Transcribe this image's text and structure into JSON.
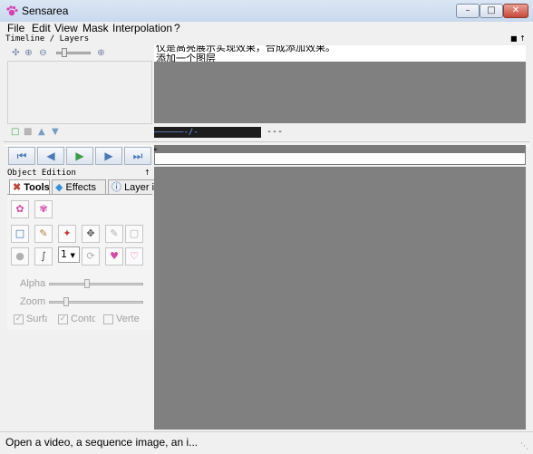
{
  "window": {
    "title": "Sensarea",
    "min_label": "–",
    "max_label": "□",
    "close_label": "✕"
  },
  "menu": [
    "File",
    "Edit",
    "View",
    "Mask",
    "Interpolation",
    "?"
  ],
  "timeline": {
    "header": "Timeline / Layers",
    "header_buttons": "■ ↑",
    "text_line1": "仅是高亮展示实现效果，合成添加效果。",
    "text_line2": "添加一个图层",
    "track_label": "——————-/-",
    "track_dashes": "---",
    "frame_marker": "▸"
  },
  "transport": {
    "first": "⏮",
    "prev": "◀",
    "play": "▶",
    "next": "▶",
    "last": "⏭"
  },
  "object_edition": {
    "header": "Object Edition",
    "pin": "↑",
    "tabs": [
      {
        "label": "Tools",
        "icon": "tools-icon"
      },
      {
        "label": "Effects",
        "icon": "effects-icon"
      },
      {
        "label": "Layer info",
        "icon": "info-icon"
      }
    ],
    "brush_size": "1",
    "alpha_label": "Alpha",
    "zoom_label": "Zoom",
    "checkboxes": [
      "Surface",
      "Contour",
      "Vertex"
    ]
  },
  "status": {
    "text": "Open a video, a sequence image, an i..."
  },
  "colors": {
    "canvas_bg": "#808080",
    "track_bg": "#1d1d1d",
    "close_red": "#c7483a"
  }
}
